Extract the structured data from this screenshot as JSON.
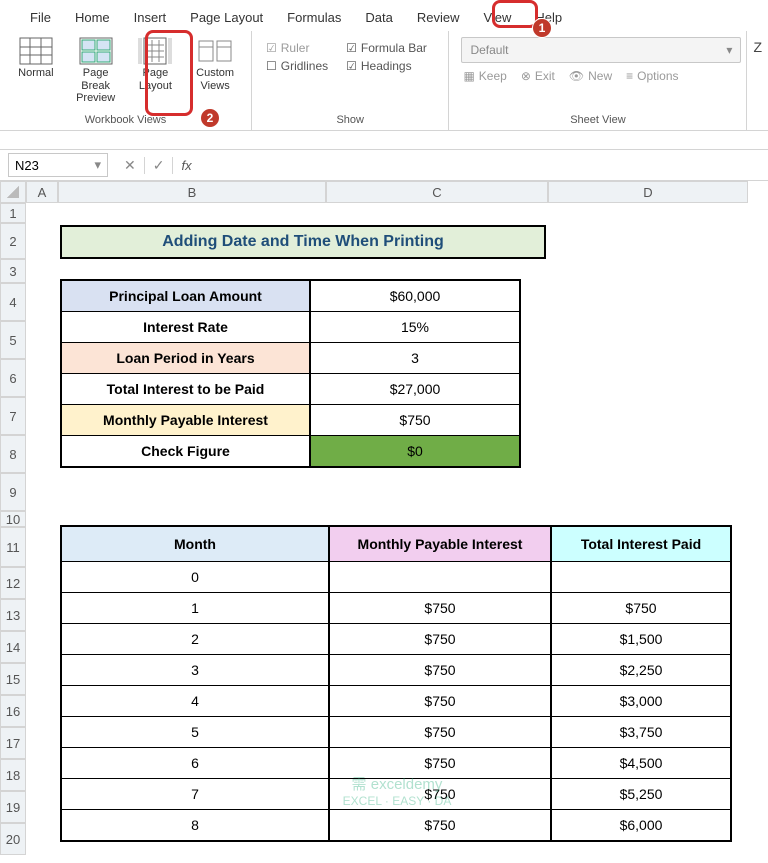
{
  "menu": {
    "items": [
      "File",
      "Home",
      "Insert",
      "Page Layout",
      "Formulas",
      "Data",
      "Review",
      "View",
      "Help"
    ],
    "active": "View"
  },
  "ribbon": {
    "views": {
      "normal": "Normal",
      "pageBreak": "Page Break\nPreview",
      "pageLayout": "Page\nLayout",
      "custom": "Custom\nViews",
      "group": "Workbook Views"
    },
    "show": {
      "ruler": "Ruler",
      "gridlines": "Gridlines",
      "formulaBar": "Formula Bar",
      "headings": "Headings",
      "group": "Show"
    },
    "sheetview": {
      "default": "Default",
      "keep": "Keep",
      "exit": "Exit",
      "new": "New",
      "options": "Options",
      "group": "Sheet View"
    },
    "zoomLetter": "Z"
  },
  "namebox": "N23",
  "fx": "fx",
  "title": "Adding Date and Time When Printing",
  "summary": [
    {
      "label": "Principal Loan Amount",
      "value": "$60,000",
      "cls": "bg-blue"
    },
    {
      "label": "Interest Rate",
      "value": "15%",
      "cls": ""
    },
    {
      "label": "Loan Period in Years",
      "value": "3",
      "cls": "bg-pink"
    },
    {
      "label": "Total Interest to be Paid",
      "value": "$27,000",
      "cls": ""
    },
    {
      "label": "Monthly Payable Interest",
      "value": "$750",
      "cls": "bg-tan"
    },
    {
      "label": "Check Figure",
      "value": "$0",
      "cls": "",
      "valcls": "bg-green"
    }
  ],
  "table": {
    "headers": [
      "Month",
      "Monthly Payable Interest",
      "Total Interest Paid"
    ],
    "rows": [
      [
        "0",
        "",
        ""
      ],
      [
        "1",
        "$750",
        "$750"
      ],
      [
        "2",
        "$750",
        "$1,500"
      ],
      [
        "3",
        "$750",
        "$2,250"
      ],
      [
        "4",
        "$750",
        "$3,000"
      ],
      [
        "5",
        "$750",
        "$3,750"
      ],
      [
        "6",
        "$750",
        "$4,500"
      ],
      [
        "7",
        "$750",
        "$5,250"
      ],
      [
        "8",
        "$750",
        "$6,000"
      ]
    ]
  },
  "cols": [
    "A",
    "B",
    "C",
    "D"
  ],
  "rows": [
    "1",
    "2",
    "3",
    "4",
    "5",
    "6",
    "7",
    "8",
    "9",
    "10",
    "11",
    "12",
    "13",
    "14",
    "15",
    "16",
    "17",
    "18",
    "19",
    "20"
  ],
  "watermark": {
    "line1": "需 exceldemy",
    "line2": "EXCEL · EASY · DA"
  }
}
